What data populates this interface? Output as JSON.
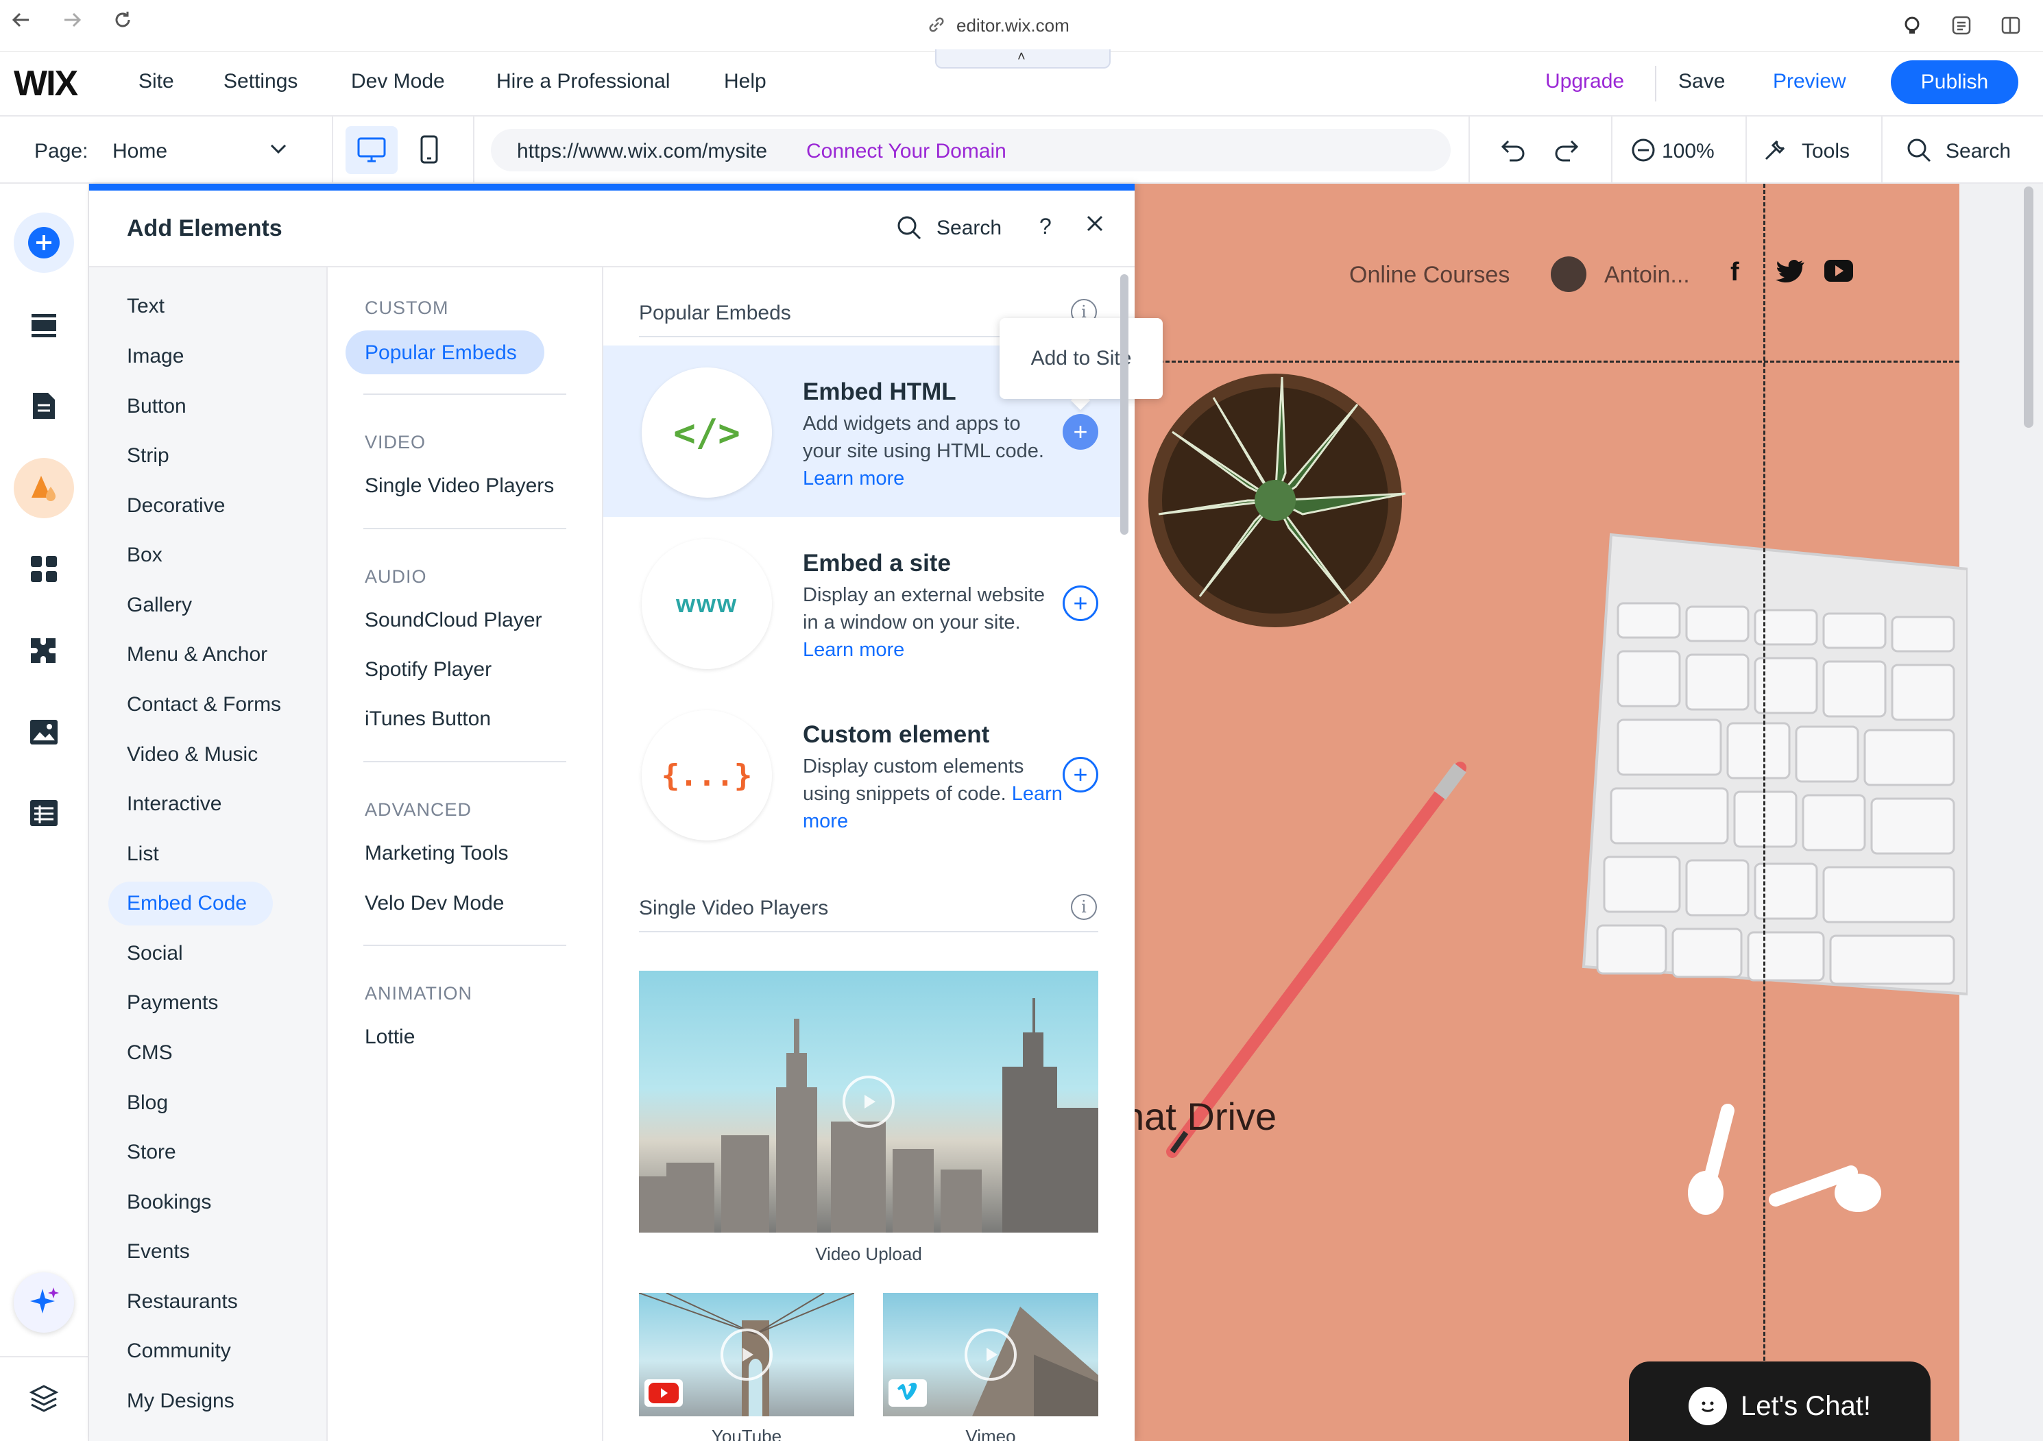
{
  "browser": {
    "url": "editor.wix.com"
  },
  "topbar": {
    "logo": "WIX",
    "menu": [
      "Site",
      "Settings",
      "Dev Mode",
      "Hire a Professional",
      "Help"
    ],
    "upgrade": "Upgrade",
    "save": "Save",
    "preview": "Preview",
    "publish": "Publish"
  },
  "secondbar": {
    "page_label": "Page:",
    "page_name": "Home",
    "site_url": "https://www.wix.com/mysite",
    "connect_domain": "Connect Your Domain",
    "zoom": "100%",
    "tools": "Tools",
    "search": "Search"
  },
  "panel": {
    "title": "Add Elements",
    "search": "Search",
    "help": "?",
    "categories": [
      "Text",
      "Image",
      "Button",
      "Strip",
      "Decorative",
      "Box",
      "Gallery",
      "Menu & Anchor",
      "Contact & Forms",
      "Video & Music",
      "Interactive",
      "List",
      "Embed Code",
      "Social",
      "Payments",
      "CMS",
      "Blog",
      "Store",
      "Bookings",
      "Events",
      "Restaurants",
      "Community",
      "My Designs"
    ],
    "active_category": "Embed Code",
    "subsections": {
      "custom_head": "CUSTOM",
      "custom_items": [
        "Popular Embeds"
      ],
      "video_head": "VIDEO",
      "video_items": [
        "Single Video Players"
      ],
      "audio_head": "AUDIO",
      "audio_items": [
        "SoundCloud Player",
        "Spotify Player",
        "iTunes Button"
      ],
      "advanced_head": "ADVANCED",
      "advanced_items": [
        "Marketing Tools",
        "Velo Dev Mode"
      ],
      "animation_head": "ANIMATION",
      "animation_items": [
        "Lottie"
      ]
    },
    "popular_title": "Popular Embeds",
    "tooltip": "Add to Site",
    "embeds": [
      {
        "title": "Embed HTML",
        "desc": "Add widgets and apps to your site using HTML code.",
        "learn": "Learn more",
        "icon_text": "</>"
      },
      {
        "title": "Embed a site",
        "desc": "Display an external website in a window on your site.",
        "learn": "Learn more",
        "icon_text": "www"
      },
      {
        "title": "Custom element",
        "desc": "Display custom elements using snippets of code.",
        "learn": "Learn more",
        "icon_text": "{...}"
      }
    ],
    "video_section_title": "Single Video Players",
    "videos": [
      {
        "label": "Video Upload"
      },
      {
        "label": "YouTube"
      },
      {
        "label": "Vimeo"
      }
    ]
  },
  "site": {
    "nav_online_courses": "Online Courses",
    "nav_user": "Antoin...",
    "heading_fragment": "hat Drive",
    "chat": "Let's Chat!"
  },
  "colors": {
    "accent": "#116dff",
    "upgrade": "#9a27d5",
    "site_bg": "#e59b80"
  }
}
